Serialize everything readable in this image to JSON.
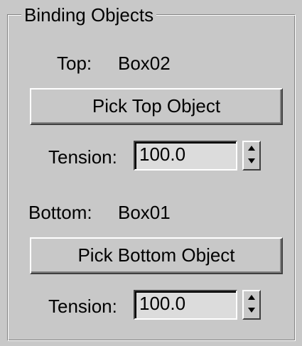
{
  "group": {
    "title": "Binding Objects"
  },
  "top": {
    "label": "Top:",
    "object_name": "Box02",
    "pick_button": "Pick Top Object",
    "tension_label": "Tension:",
    "tension_value": "100.0",
    "spinner_icon": "spinner-up-down-icon"
  },
  "bottom": {
    "label": "Bottom:",
    "object_name": "Box01",
    "pick_button": "Pick Bottom Object",
    "tension_label": "Tension:",
    "tension_value": "100.0",
    "spinner_icon": "spinner-up-down-icon"
  }
}
